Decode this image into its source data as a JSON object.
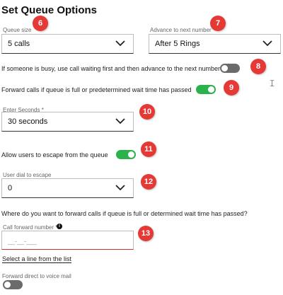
{
  "title": "Set Queue Options",
  "queue_size": {
    "label": "Queue size",
    "value": "5 calls"
  },
  "advance": {
    "label": "Advance to next number",
    "value": "After 5 Rings"
  },
  "busy_toggle": {
    "label": "If someone is busy, use call waiting first and then advance to the next number",
    "on": false
  },
  "forward_toggle": {
    "label": "Forward calls if queue is full or predetermined wait time has passed",
    "on": true
  },
  "seconds": {
    "label": "Enter Seconds *",
    "value": "30 seconds"
  },
  "escape_toggle": {
    "label": "Allow users to escape from the queue",
    "on": true
  },
  "escape_dial": {
    "label": "User dial to escape",
    "value": "0"
  },
  "forward_question": "Where do you want to forward calls if queue is full or determined wait time has passed?",
  "call_forward": {
    "label": "Call forward number *",
    "placeholder": "__-__-___"
  },
  "select_line_link": "Select a line from the list",
  "voicemail_toggle": {
    "label": "Forward direct to voice mail",
    "on": false
  },
  "badges": [
    "6",
    "7",
    "8",
    "9",
    "10",
    "11",
    "12",
    "13"
  ],
  "colors": {
    "toggle_on": "#2bb24c",
    "toggle_off": "#6b6b6b",
    "badge": "#e53935",
    "error_underline": "#d32f2f"
  }
}
